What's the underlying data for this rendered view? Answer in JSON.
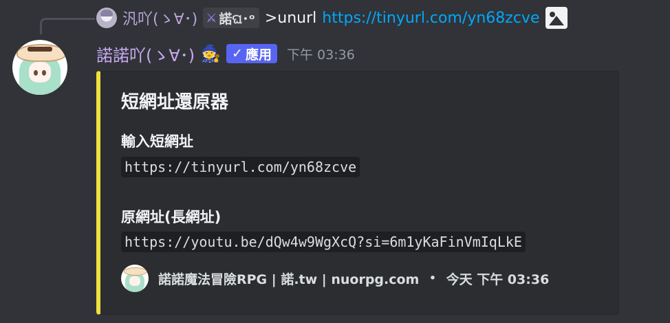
{
  "reply": {
    "username": "汎吖(ゝ∀･)",
    "tag_text": "諾ଘ･ᵒ",
    "tag_icon": "sword-icon",
    "command": ">unurl",
    "link": "https://tinyurl.com/yn68zcve",
    "attachment_icon": "image-icon"
  },
  "message": {
    "username": "諾諾吖(ゝ∀･)",
    "role_icon": "wizard-hat-icon",
    "badge_label": "應用",
    "badge_check": "✓",
    "timestamp": "下午 03:36"
  },
  "embed": {
    "accent_color": "#f0e03c",
    "title": "短網址還原器",
    "fields": [
      {
        "name": "輸入短網址",
        "value": "https://tinyurl.com/yn68zcve"
      },
      {
        "name": "原網址(長網址)",
        "value": "https://youtu.be/dQw4w9WgXcQ?si=6m1yKaFinVmIqLkE"
      }
    ],
    "footer": {
      "text": "諾諾魔法冒險RPG | 諾.tw | nuorpg.com",
      "separator": "•",
      "time": "今天 下午 03:36"
    }
  }
}
